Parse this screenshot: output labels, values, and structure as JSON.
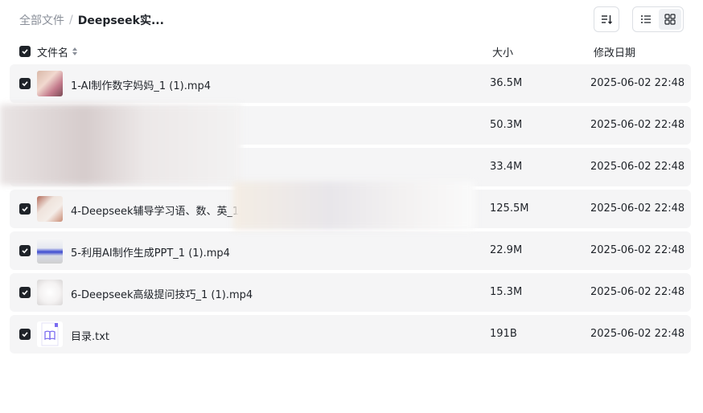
{
  "breadcrumb": {
    "root": "全部文件",
    "separator": "/",
    "current": "Deepseek实..."
  },
  "header": {
    "name": "文件名",
    "size": "大小",
    "date": "修改日期"
  },
  "files": [
    {
      "name": "1-AI制作数字妈妈_1 (1).mp4",
      "size": "36.5M",
      "date": "2025-06-02 22:48",
      "thumb": "video-thumb"
    },
    {
      "name": "",
      "size": "50.3M",
      "date": "2025-06-02 22:48",
      "thumb": ""
    },
    {
      "name": "",
      "size": "33.4M",
      "date": "2025-06-02 22:48",
      "thumb": ""
    },
    {
      "name": "4-Deepseek辅导学习语、数、英_1 (1",
      "size": "125.5M",
      "date": "2025-06-02 22:48",
      "thumb": "video-thumb"
    },
    {
      "name": "5-利用AI制作生成PPT_1 (1).mp4",
      "size": "22.9M",
      "date": "2025-06-02 22:48",
      "thumb": "video-thumb"
    },
    {
      "name": "6-Deepseek高级提问技巧_1 (1).mp4",
      "size": "15.3M",
      "date": "2025-06-02 22:48",
      "thumb": "video-thumb"
    },
    {
      "name": "目录.txt",
      "size": "191B",
      "date": "2025-06-02 22:48",
      "thumb": "txt-icon"
    }
  ],
  "colors": {
    "accent": "#7b6cf0",
    "row_bg": "#f5f5f6",
    "text": "#1f2329",
    "muted": "#8a8f99"
  }
}
